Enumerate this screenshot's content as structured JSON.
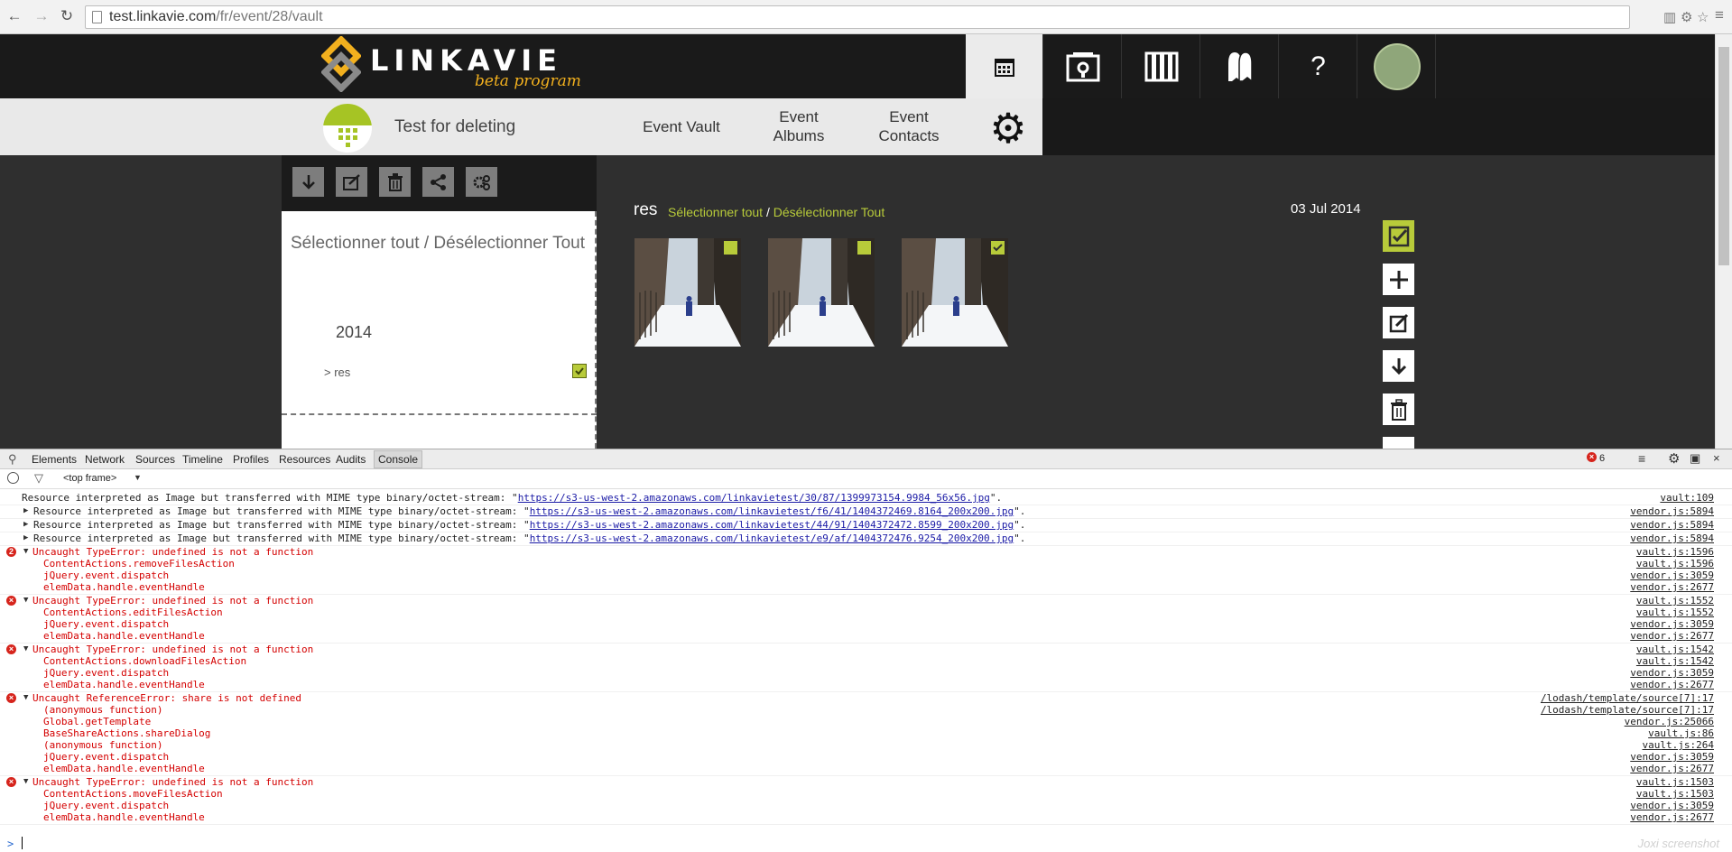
{
  "browser": {
    "url_host": "test.linkavie.com",
    "url_path": "/fr/event/28/vault"
  },
  "site": {
    "brand_name": "LINKAVIE",
    "brand_tagline": "beta program",
    "help_label": "?",
    "accent_color": "#b8cb3a"
  },
  "event": {
    "name": "Test for deleting",
    "nav": [
      "Event Vault",
      "Event Albums",
      "Event Contacts"
    ]
  },
  "sidebar": {
    "select_all_label": "Sélectionner tout / Désélectionner Tout",
    "year": "2014",
    "album_item": "> res"
  },
  "content": {
    "album_title": "res",
    "select_all": "Sélectionner tout",
    "separator": "/",
    "deselect_all": "Désélectionner Tout",
    "date": "03 Jul 2014",
    "photo_count": 3
  },
  "devtools": {
    "tabs": [
      "Elements",
      "Network",
      "Sources",
      "Timeline",
      "Profiles",
      "Resources",
      "Audits",
      "Console"
    ],
    "active_tab": "Console",
    "error_count": "6",
    "frame_selector": "<top frame>",
    "warnings": [
      {
        "prefix": "Resource interpreted as Image but transferred with MIME type binary/octet-stream: \"",
        "url": "https://s3-us-west-2.amazonaws.com/linkavietest/30/87/1399973154.9984_56x56.jpg",
        "suffix": "\".",
        "src": "vault:109"
      },
      {
        "prefix": "Resource interpreted as Image but transferred with MIME type binary/octet-stream: \"",
        "url": "https://s3-us-west-2.amazonaws.com/linkavietest/f6/41/1404372469.8164_200x200.jpg",
        "suffix": "\".",
        "src": "vendor.js:5894"
      },
      {
        "prefix": "Resource interpreted as Image but transferred with MIME type binary/octet-stream: \"",
        "url": "https://s3-us-west-2.amazonaws.com/linkavietest/44/91/1404372472.8599_200x200.jpg",
        "suffix": "\".",
        "src": "vendor.js:5894"
      },
      {
        "prefix": "Resource interpreted as Image but transferred with MIME type binary/octet-stream: \"",
        "url": "https://s3-us-west-2.amazonaws.com/linkavietest/e9/af/1404372476.9254_200x200.jpg",
        "suffix": "\".",
        "src": "vendor.js:5894"
      }
    ],
    "errors": [
      {
        "badge": "2",
        "message": "Uncaught TypeError: undefined is not a function",
        "src": "vault.js:1596",
        "stack": [
          [
            "ContentActions.removeFilesAction",
            "vault.js:1596"
          ],
          [
            "jQuery.event.dispatch",
            "vendor.js:3059"
          ],
          [
            "elemData.handle.eventHandle",
            "vendor.js:2677"
          ]
        ]
      },
      {
        "badge": "",
        "message": "Uncaught TypeError: undefined is not a function",
        "src": "vault.js:1552",
        "stack": [
          [
            "ContentActions.editFilesAction",
            "vault.js:1552"
          ],
          [
            "jQuery.event.dispatch",
            "vendor.js:3059"
          ],
          [
            "elemData.handle.eventHandle",
            "vendor.js:2677"
          ]
        ]
      },
      {
        "badge": "",
        "message": "Uncaught TypeError: undefined is not a function",
        "src": "vault.js:1542",
        "stack": [
          [
            "ContentActions.downloadFilesAction",
            "vault.js:1542"
          ],
          [
            "jQuery.event.dispatch",
            "vendor.js:3059"
          ],
          [
            "elemData.handle.eventHandle",
            "vendor.js:2677"
          ]
        ]
      },
      {
        "badge": "",
        "message": "Uncaught ReferenceError: share is not defined",
        "src": "/lodash/template/source[7]:17",
        "stack": [
          [
            "(anonymous function)",
            "/lodash/template/source[7]:17"
          ],
          [
            "Global.getTemplate",
            "vendor.js:25066"
          ],
          [
            "BaseShareActions.shareDialog",
            "vault.js:86"
          ],
          [
            "(anonymous function)",
            "vault.js:264"
          ],
          [
            "jQuery.event.dispatch",
            "vendor.js:3059"
          ],
          [
            "elemData.handle.eventHandle",
            "vendor.js:2677"
          ]
        ]
      },
      {
        "badge": "",
        "message": "Uncaught TypeError: undefined is not a function",
        "src": "vault.js:1503",
        "stack": [
          [
            "ContentActions.moveFilesAction",
            "vault.js:1503"
          ],
          [
            "jQuery.event.dispatch",
            "vendor.js:3059"
          ],
          [
            "elemData.handle.eventHandle",
            "vendor.js:2677"
          ]
        ]
      }
    ],
    "prompt": ">"
  },
  "watermark": "Joxi screenshot"
}
